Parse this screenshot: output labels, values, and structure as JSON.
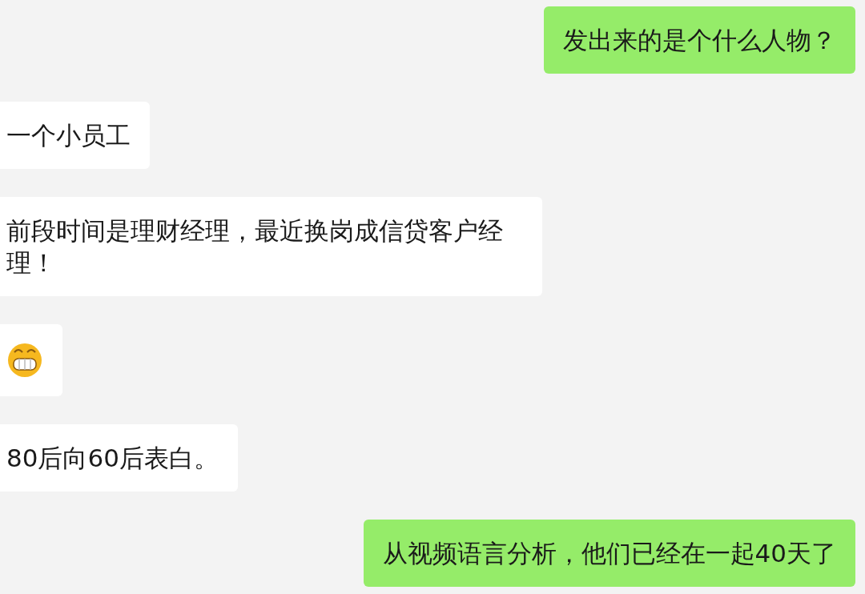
{
  "messages": [
    {
      "outgoing": true,
      "kind": "text",
      "text": "发出来的是个什么人物？"
    },
    {
      "outgoing": false,
      "kind": "text",
      "text": "一个小员工"
    },
    {
      "outgoing": false,
      "kind": "text",
      "text": "前段时间是理财经理，最近换岗成信贷客户经理！"
    },
    {
      "outgoing": false,
      "kind": "emoji"
    },
    {
      "outgoing": false,
      "kind": "text",
      "text": "80后向60后表白。"
    },
    {
      "outgoing": true,
      "kind": "text",
      "text": "从视频语言分析，他们已经在一起40天了"
    }
  ]
}
